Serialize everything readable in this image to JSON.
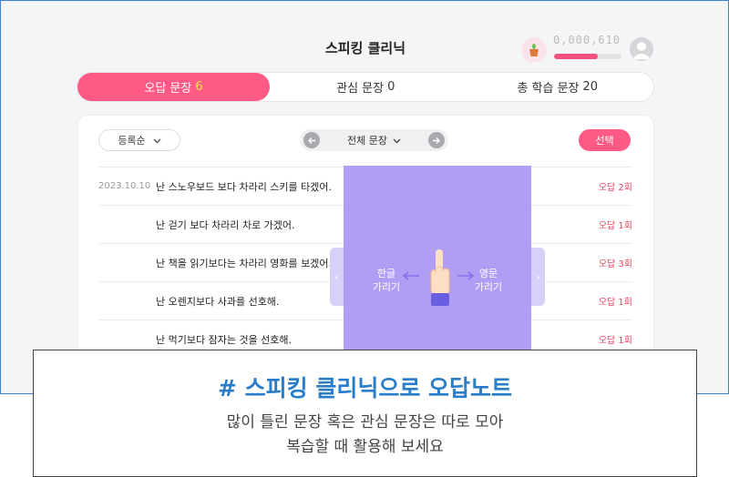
{
  "header": {
    "title": "스피킹 클리닉",
    "points": "0,000,610",
    "progress_fraction": 0.65,
    "pot_icon": "plant-pot-icon",
    "user_icon": "user-avatar-icon"
  },
  "tabs": [
    {
      "label": "오답 문장",
      "count": "6",
      "active": true
    },
    {
      "label": "관심 문장",
      "count": "0",
      "active": false
    },
    {
      "label": "총 학습 문장",
      "count": "20",
      "active": false
    }
  ],
  "toolbar": {
    "sort_label": "등록순",
    "filter_label": "전체 문장",
    "select_label": "선택"
  },
  "rows": [
    {
      "date": "2023.10.10",
      "sentence": "난 스노우보드 보다 차라리 스키를 타겠어.",
      "wrong": "오답 2회"
    },
    {
      "date": "",
      "sentence": "난 걷기 보다 차라리 차로 가겠어.",
      "wrong": "오답 1회"
    },
    {
      "date": "",
      "sentence": "난 책을 읽기보다는 차라리 영화를 보겠어.",
      "wrong": "오답 3회"
    },
    {
      "date": "",
      "sentence": "난 오렌지보다 사과를 선호해.",
      "wrong": "오답 1회"
    },
    {
      "date": "",
      "sentence": "난 먹기보다 잠자는 것을 선호해.",
      "wrong": "오답 1회"
    }
  ],
  "overlay": {
    "left_line1": "한글",
    "left_line2": "가리기",
    "right_line1": "영문",
    "right_line2": "가리기",
    "hand_icon": "pointing-hand-icon"
  },
  "caption": {
    "title": "# 스피킹 클리닉으로 오답노트",
    "line1": "많이 틀린 문장 혹은 관심 문장은 따로 모아",
    "line2": "복습할 때 활용해 보세요"
  },
  "colors": {
    "accent": "#ff5a86",
    "overlay": "#b29df4",
    "caption_title": "#2a7dc9"
  }
}
